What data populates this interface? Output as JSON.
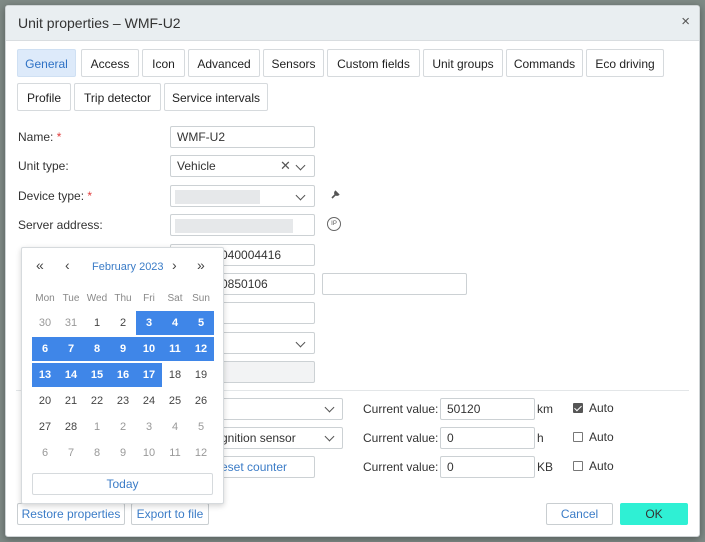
{
  "window": {
    "title": "Unit properties – WMF-U2",
    "close_glyph": "×"
  },
  "tabs": [
    {
      "label": "General",
      "active": true
    },
    {
      "label": "Access"
    },
    {
      "label": "Icon"
    },
    {
      "label": "Advanced"
    },
    {
      "label": "Sensors"
    },
    {
      "label": "Custom fields"
    },
    {
      "label": "Unit groups"
    },
    {
      "label": "Commands"
    },
    {
      "label": "Eco driving"
    },
    {
      "label": "Profile"
    },
    {
      "label": "Trip detector"
    },
    {
      "label": "Service intervals"
    }
  ],
  "form": {
    "name_label": "Name:",
    "name_value": "WMF-U2",
    "unit_type_label": "Unit type:",
    "unit_type_value": "Vehicle",
    "device_type_label": "Device type:",
    "server_address_label": "Server address:",
    "required_mark": "*",
    "unique_id_partial": "040004416",
    "phone_partial": "0850106"
  },
  "counters": [
    {
      "current_label": "Current value:",
      "value": "50120",
      "unit": "km",
      "auto_label": "Auto",
      "auto": true
    },
    {
      "current_label": "Current value:",
      "value": "0",
      "unit": "h",
      "auto_label": "Auto",
      "auto": false,
      "source_partial": "gnition sensor"
    },
    {
      "current_label": "Current value:",
      "value": "0",
      "unit": "KB",
      "auto_label": "Auto",
      "auto": false,
      "reset_partial": "eset counter"
    }
  ],
  "footer": {
    "restore_label": "Restore properties",
    "export_label": "Export to file",
    "cancel_label": "Cancel",
    "ok_label": "OK"
  },
  "calendar": {
    "month_label": "February 2023",
    "prev_year": "«",
    "prev_month": "‹",
    "next_month": "›",
    "next_year": "»",
    "weekdays": [
      "Mon",
      "Tue",
      "Wed",
      "Thu",
      "Fri",
      "Sat",
      "Sun"
    ],
    "weeks": [
      [
        {
          "d": "30",
          "o": true
        },
        {
          "d": "31",
          "o": true
        },
        {
          "d": "1"
        },
        {
          "d": "2"
        },
        {
          "d": "3",
          "s": true
        },
        {
          "d": "4",
          "s": true
        },
        {
          "d": "5",
          "s": true
        }
      ],
      [
        {
          "d": "6",
          "s": true
        },
        {
          "d": "7",
          "s": true
        },
        {
          "d": "8",
          "s": true
        },
        {
          "d": "9",
          "s": true
        },
        {
          "d": "10",
          "s": true
        },
        {
          "d": "11",
          "s": true
        },
        {
          "d": "12",
          "s": true
        }
      ],
      [
        {
          "d": "13",
          "s": true
        },
        {
          "d": "14",
          "s": true
        },
        {
          "d": "15",
          "s": true
        },
        {
          "d": "16",
          "s": true
        },
        {
          "d": "17",
          "s": true
        },
        {
          "d": "18"
        },
        {
          "d": "19"
        }
      ],
      [
        {
          "d": "20"
        },
        {
          "d": "21"
        },
        {
          "d": "22"
        },
        {
          "d": "23"
        },
        {
          "d": "24"
        },
        {
          "d": "25"
        },
        {
          "d": "26"
        }
      ],
      [
        {
          "d": "27"
        },
        {
          "d": "28"
        },
        {
          "d": "1",
          "o": true
        },
        {
          "d": "2",
          "o": true
        },
        {
          "d": "3",
          "o": true
        },
        {
          "d": "4",
          "o": true
        },
        {
          "d": "5",
          "o": true
        }
      ],
      [
        {
          "d": "6",
          "o": true
        },
        {
          "d": "7",
          "o": true
        },
        {
          "d": "8",
          "o": true
        },
        {
          "d": "9",
          "o": true
        },
        {
          "d": "10",
          "o": true
        },
        {
          "d": "11",
          "o": true
        },
        {
          "d": "12",
          "o": true
        }
      ]
    ],
    "today_label": "Today"
  },
  "icons": {
    "wrench": "wrench-icon",
    "ip": "ip-icon",
    "chevron": "chevron-down-icon",
    "clear": "clear-icon"
  },
  "colors": {
    "accent": "#3f86e8",
    "ok": "#2ff0d4",
    "active_tab_bg": "#ddeafa"
  }
}
